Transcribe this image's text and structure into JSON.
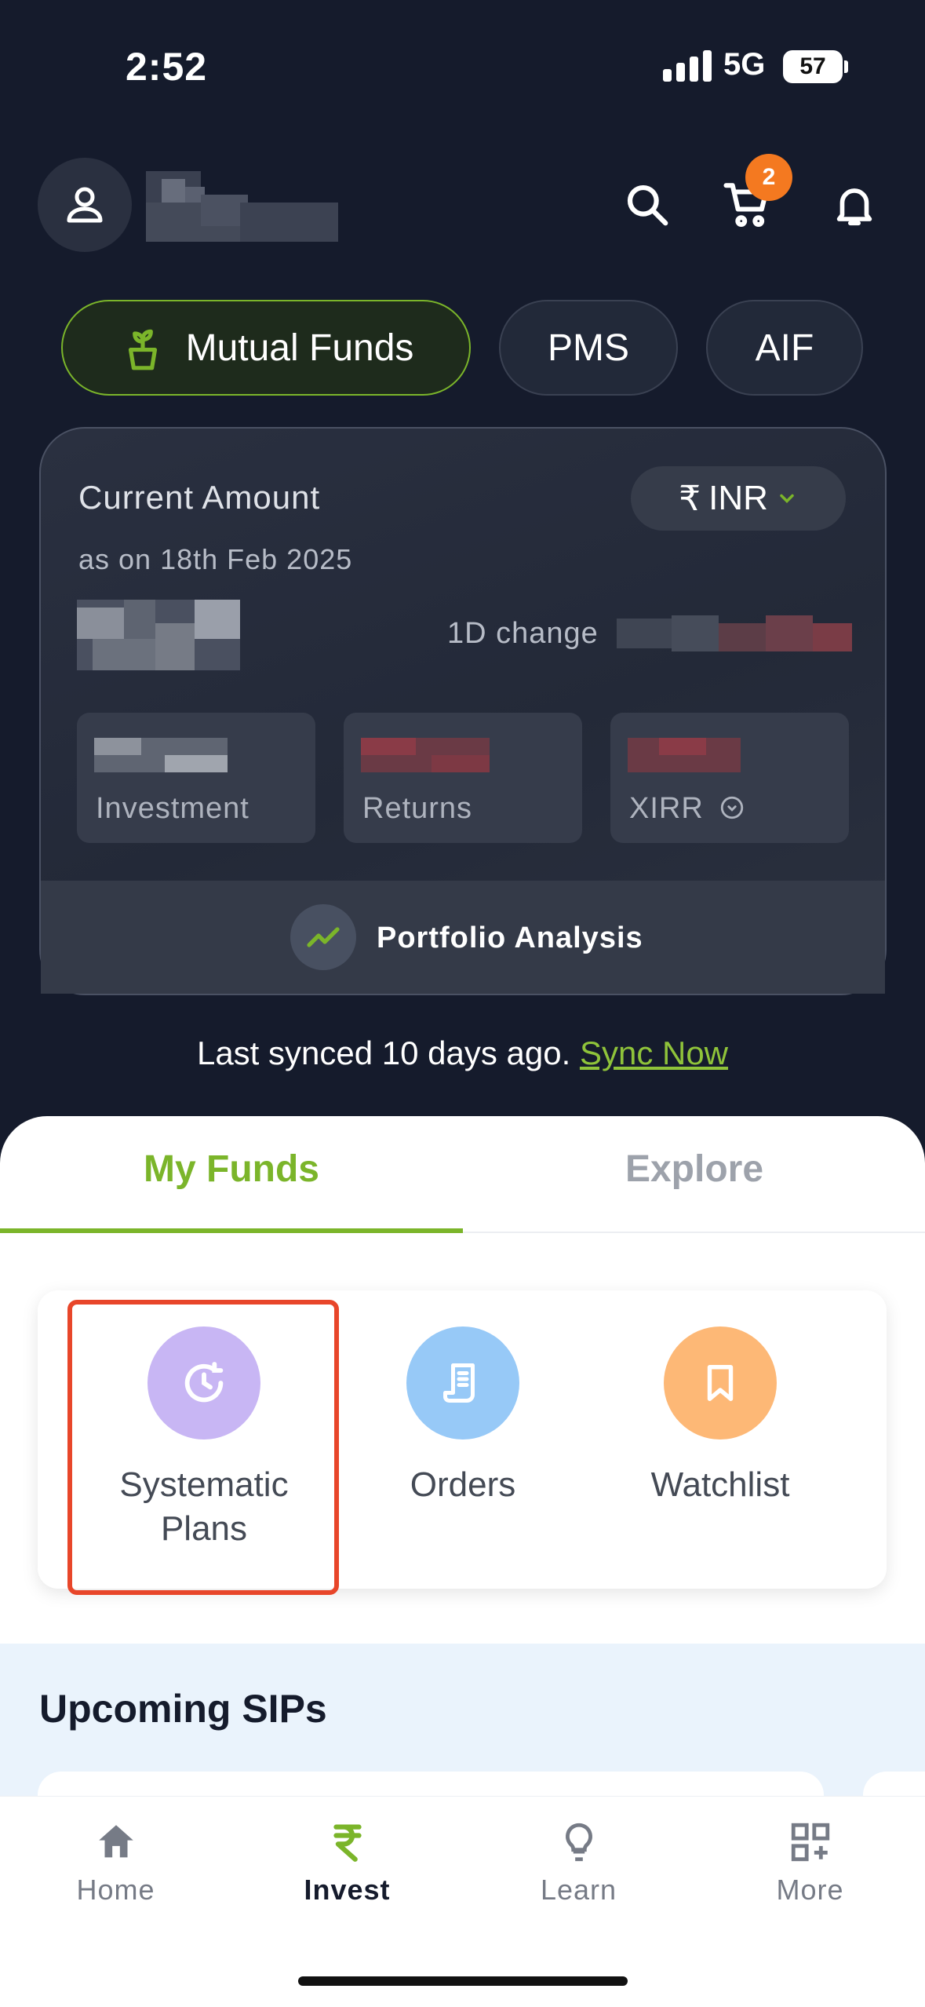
{
  "status_bar": {
    "time": "2:52",
    "network": "5G",
    "battery": "57"
  },
  "header": {
    "cart_count": "2"
  },
  "segments": [
    {
      "label": "Mutual Funds",
      "active": true
    },
    {
      "label": "PMS",
      "active": false
    },
    {
      "label": "AIF",
      "active": false
    }
  ],
  "portfolio": {
    "title": "Current Amount",
    "as_on": "as on 18th Feb 2025",
    "currency": "INR",
    "currency_symbol": "₹",
    "one_day_label": "1D change",
    "stats": [
      {
        "label": "Investment"
      },
      {
        "label": "Returns"
      },
      {
        "label": "XIRR"
      }
    ],
    "analysis_label": "Portfolio Analysis"
  },
  "sync": {
    "text": "Last synced 10 days ago. ",
    "link": "Sync Now"
  },
  "tabs": [
    {
      "label": "My Funds",
      "active": true
    },
    {
      "label": "Explore",
      "active": false
    }
  ],
  "quick_actions": [
    {
      "label_line1": "Systematic",
      "label_line2": "Plans",
      "icon": "clock-refresh-icon",
      "color": "#c8b6f4"
    },
    {
      "label_line1": "Orders",
      "icon": "receipt-icon",
      "color": "#97c9f7"
    },
    {
      "label_line1": "Watchlist",
      "icon": "bookmark-icon",
      "color": "#fdb876"
    }
  ],
  "upcoming": {
    "title": "Upcoming SIPs"
  },
  "bottom_nav": [
    {
      "label": "Home",
      "icon": "home-icon",
      "active": false
    },
    {
      "label": "Invest",
      "icon": "rupee-icon",
      "active": true
    },
    {
      "label": "Learn",
      "icon": "bulb-icon",
      "active": false
    },
    {
      "label": "More",
      "icon": "grid-plus-icon",
      "active": false
    }
  ],
  "colors": {
    "accent": "#7bb52a",
    "background": "#151b2c",
    "badge": "#f47920",
    "highlight": "#e8462a"
  }
}
